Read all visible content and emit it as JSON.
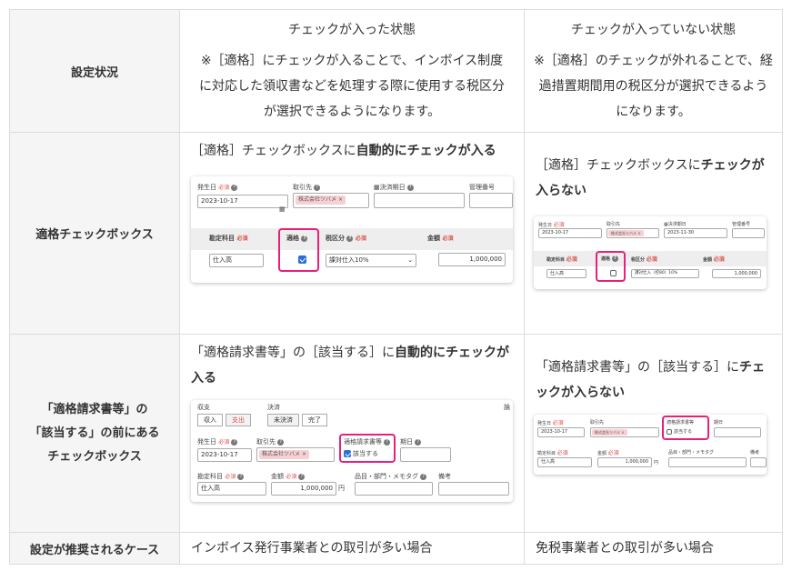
{
  "rows": {
    "status": {
      "label": "設定状況",
      "checked_title": "チェックが入った状態",
      "checked_note": "※［適格］にチェックが入ることで、インボイス制度に対応した領収書などを処理する際に使用する税区分が選択できるようになります。",
      "unchecked_title": "チェックが入っていない状態",
      "unchecked_note": "※［適格］のチェックが外れることで、経過措置期間用の税区分が選択できるようになります。"
    },
    "qualified_checkbox": {
      "label": "適格チェックボックス",
      "checked_text_plain": "［適格］チェックボックスに",
      "checked_text_bold": "自動的にチェックが入る",
      "unchecked_text_plain": "［適格］チェックボックスに",
      "unchecked_text_bold": "チェックが入らない"
    },
    "invoice_checkbox": {
      "label_line1": "「適格請求書等」の",
      "label_line2": "「該当する」の前にある",
      "label_line3": "チェックボックス",
      "checked_text_plain": "「適格請求書等」の［該当する］に",
      "checked_text_bold": "自動的にチェックが入る",
      "unchecked_text_plain": "「適格請求書等」の［該当する］に",
      "unchecked_text_bold": "チェックが入らない"
    },
    "recommended": {
      "label": "設定が推奨されるケース",
      "checked_case": "インボイス発行事業者との取引が多い場合",
      "unchecked_case": "免税事業者との取引が多い場合"
    }
  },
  "form1": {
    "issue_date_label": "発生日",
    "required": "必須",
    "partner_label": "取引先",
    "settle_date_label": "決済期日",
    "mgmt_no_label": "管理番号",
    "issue_date_value": "2023-10-17",
    "partner_value": "株式会社ツバメ",
    "account_label": "勘定科目",
    "qualified_label": "適格",
    "tax_label": "税区分",
    "amount_label": "金額",
    "account_value": "仕入高",
    "tax_value": "課対仕入10%",
    "amount_value": "1,000,000",
    "settle_date_value_small": "2023-11-30",
    "tax_value_small": "課対仕入（控80）10%"
  },
  "form2": {
    "type_label": "収支",
    "income": "収入",
    "expense": "支出",
    "settle_label": "決済",
    "unsettled": "未決済",
    "done": "完了",
    "cut_label": "論",
    "issue_date_label": "発生日",
    "required": "必須",
    "partner_label": "取引先",
    "invoice_label": "適格請求書等",
    "applicable": "該当する",
    "due_label": "期日",
    "issue_date_value": "2023-10-17",
    "partner_value": "株式会社ツバメ",
    "account_label": "勘定科目",
    "amount_label": "金額",
    "item_label": "品目・部門・メモタグ",
    "note_label": "備考",
    "account_value": "仕入高",
    "amount_value": "1,000,000",
    "yen": "円"
  },
  "glyphs": {
    "help": "?",
    "calendar": "▦",
    "close": "×",
    "chevron": "⌄"
  }
}
